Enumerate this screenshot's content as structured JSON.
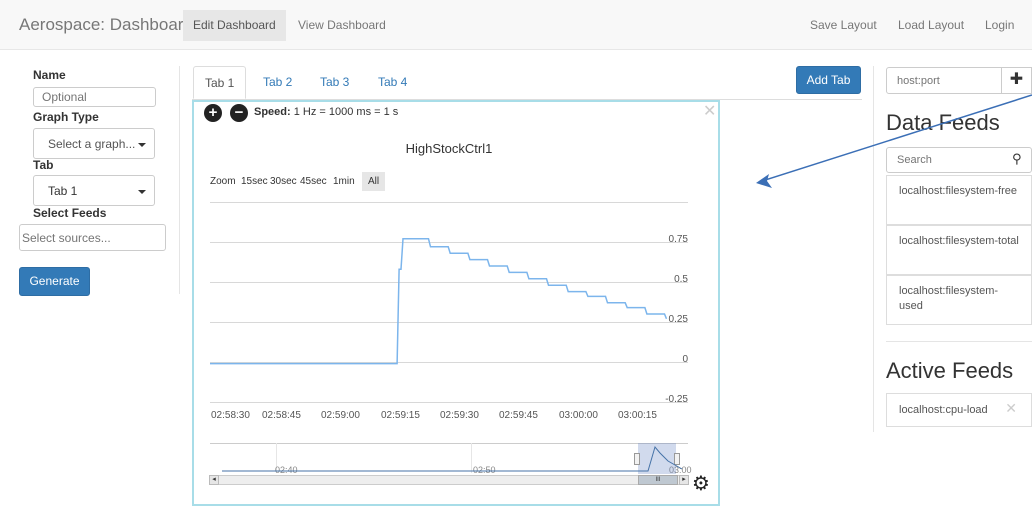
{
  "navbar": {
    "brand": "Aerospace: Dashboard",
    "edit": "Edit Dashboard",
    "view": "View Dashboard",
    "save_layout": "Save Layout",
    "load_layout": "Load Layout",
    "login": "Login"
  },
  "form": {
    "name_label": "Name",
    "name_placeholder": "Optional",
    "graph_type_label": "Graph Type",
    "graph_type_value": "Select a graph...",
    "tab_label": "Tab",
    "tab_value": "Tab 1",
    "feeds_label": "Select Feeds",
    "feeds_placeholder": "Select sources...",
    "generate": "Generate"
  },
  "tabs": [
    "Tab 1",
    "Tab 2",
    "Tab 3",
    "Tab 4"
  ],
  "add_tab": "Add Tab",
  "panel": {
    "speed_label": "Speed:",
    "speed_value": "1 Hz = 1000 ms = 1 s",
    "zoom_label": "Zoom",
    "zoom_buttons": [
      "15sec",
      "30sec",
      "45sec",
      "1min",
      "All"
    ],
    "navigator_labels": [
      "02:40",
      "02:50",
      "03:00"
    ],
    "scrollbar_grip": "III"
  },
  "chart_data": {
    "type": "line",
    "title": "HighStockCtrl1",
    "xlabel": "",
    "ylabel": "",
    "x_tick_labels": [
      "02:58:30",
      "02:58:45",
      "02:59:00",
      "02:59:15",
      "02:59:30",
      "02:59:45",
      "03:00:00",
      "03:00:15"
    ],
    "y_tick_labels": [
      "0.75",
      "0.5",
      "0.25",
      "0",
      "-0.25"
    ],
    "ylim": [
      -0.25,
      0.75
    ],
    "grid": true,
    "series": [
      {
        "color": "#7cb5ec",
        "x": [
          "02:58:30",
          "02:59:12",
          "02:59:14",
          "02:59:15",
          "02:59:18",
          "02:59:22",
          "02:59:27",
          "02:59:32",
          "02:59:37",
          "02:59:42",
          "02:59:47",
          "02:59:52",
          "02:59:57",
          "03:00:02",
          "03:00:07",
          "03:00:12",
          "03:00:17",
          "03:00:22"
        ],
        "y": [
          -0.01,
          -0.01,
          0.58,
          0.77,
          0.77,
          0.72,
          0.68,
          0.64,
          0.6,
          0.56,
          0.52,
          0.48,
          0.44,
          0.41,
          0.37,
          0.34,
          0.3,
          0.27
        ]
      }
    ]
  },
  "sidebar": {
    "host_placeholder": "host:port",
    "data_feeds_heading": "Data Feeds",
    "search_placeholder": "Search",
    "feeds": [
      "localhost:filesystem-free",
      "localhost:filesystem-total",
      "localhost:filesystem-used"
    ],
    "active_feeds_heading": "Active Feeds",
    "active_feeds": [
      "localhost:cpu-load"
    ]
  },
  "colors": {
    "accent": "#337ab7",
    "series": "#7cb5ec",
    "panel_border": "#a8dde8",
    "annotation_arrow": "#3b6fb6"
  },
  "icons": {
    "add_host": "plus-icon",
    "search": "search-icon",
    "zoom_in": "plus-circle-icon",
    "zoom_out": "minus-circle-icon",
    "close": "close-icon",
    "settings": "gear-icon",
    "remove_feed": "close-icon"
  }
}
